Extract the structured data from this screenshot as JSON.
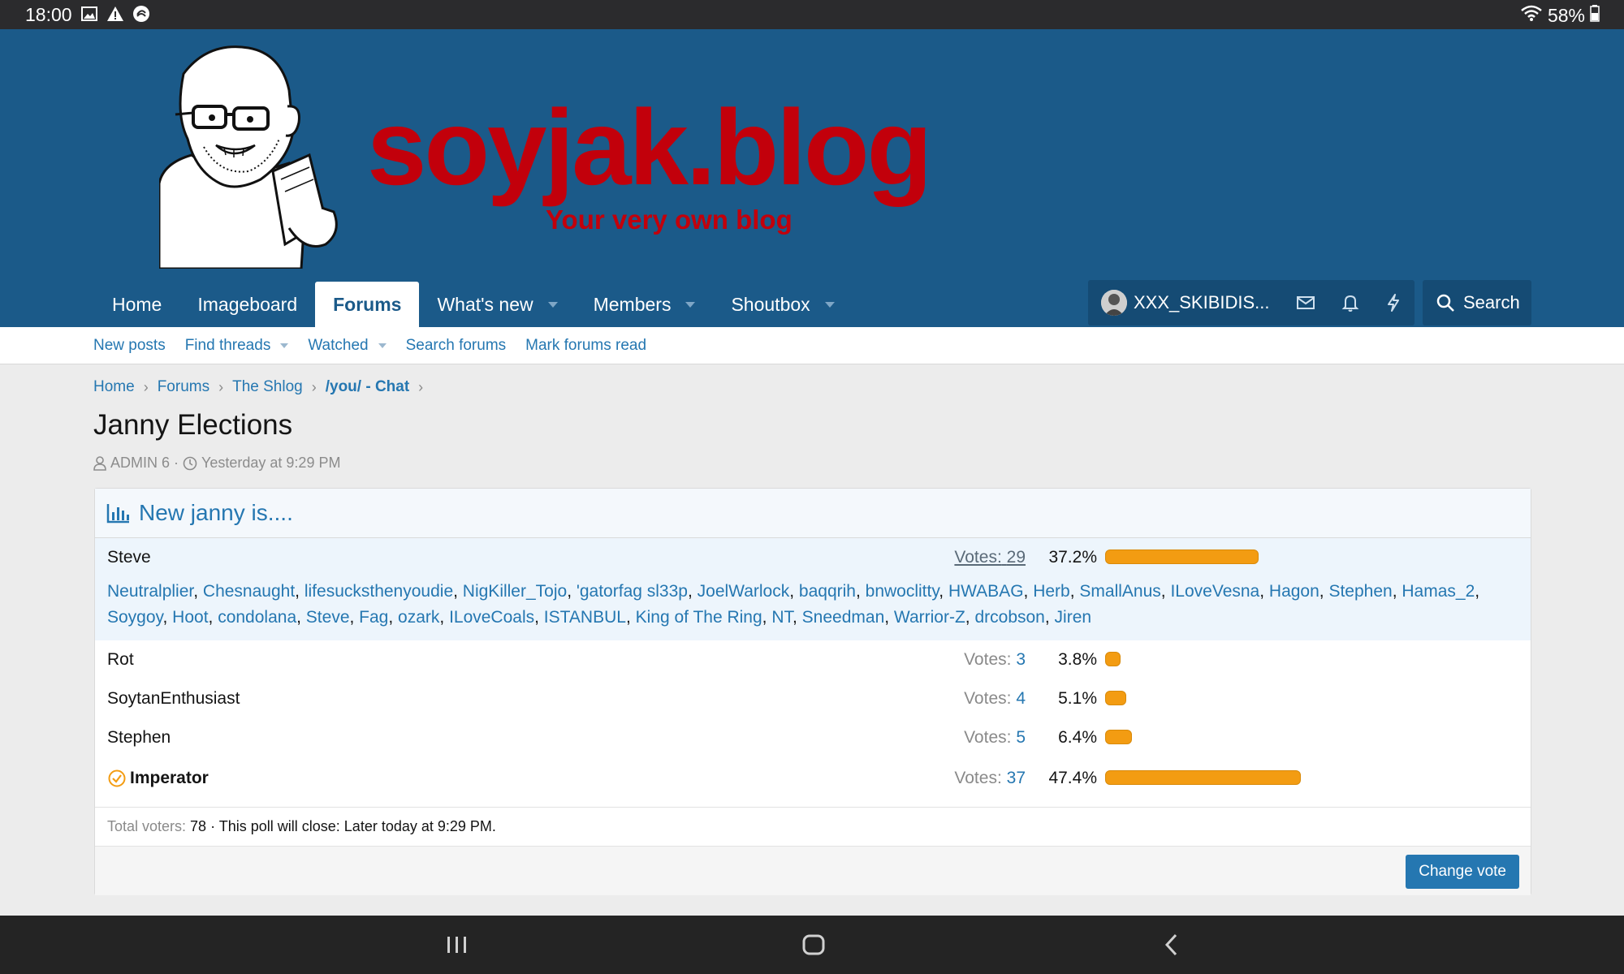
{
  "status_bar": {
    "time": "18:00",
    "battery": "58%"
  },
  "header": {
    "brand": "soyjak.blog",
    "tagline": "Your very own blog"
  },
  "nav": {
    "tabs": [
      {
        "label": "Home"
      },
      {
        "label": "Imageboard"
      },
      {
        "label": "Forums"
      },
      {
        "label": "What's new"
      },
      {
        "label": "Members"
      },
      {
        "label": "Shoutbox"
      }
    ],
    "user": "XXX_SKIBIDIS...",
    "search": "Search"
  },
  "subnav": [
    "New posts",
    "Find threads",
    "Watched",
    "Search forums",
    "Mark forums read"
  ],
  "breadcrumb": [
    "Home",
    "Forums",
    "The Shlog",
    "/you/ - Chat"
  ],
  "thread": {
    "title": "Janny Elections",
    "author": "ADMIN 6",
    "sep": "·",
    "date": "Yesterday at 9:29 PM"
  },
  "poll": {
    "question": "New janny is....",
    "votes_label": "Votes:",
    "options": [
      {
        "name": "Steve",
        "votes": "29",
        "pct": "37.2%",
        "percent": 37.2
      },
      {
        "name": "Rot",
        "votes": "3",
        "pct": "3.8%",
        "percent": 3.8
      },
      {
        "name": "SoytanEnthusiast",
        "votes": "4",
        "pct": "5.1%",
        "percent": 5.1
      },
      {
        "name": "Stephen",
        "votes": "5",
        "pct": "6.4%",
        "percent": 6.4
      },
      {
        "name": "Imperator",
        "votes": "37",
        "pct": "47.4%",
        "percent": 47.4
      }
    ],
    "steve_voters": [
      "Neutralplier",
      "Chesnaught",
      "lifesucksthenyoudie",
      "NigKiller_Tojo",
      "'gatorfag sl33p",
      "JoelWarlock",
      "baqqrih",
      "bnwoclitty",
      "HWABAG",
      "Herb",
      "SmallAnus",
      "ILoveVesna",
      "Hagon",
      "Stephen",
      "Hamas_2",
      "Soygoy",
      "Hoot",
      "condolana",
      "Steve",
      "Fag",
      "ozark",
      "ILoveCoals",
      "ISTANBUL",
      "King of The Ring",
      "NT",
      "Sneedman",
      "Warrior-Z",
      "drcobson",
      "Jiren"
    ],
    "total_label": "Total voters:",
    "total": "78",
    "close_text": "· This poll will close: Later today at 9:29 PM.",
    "change_vote": "Change vote"
  }
}
